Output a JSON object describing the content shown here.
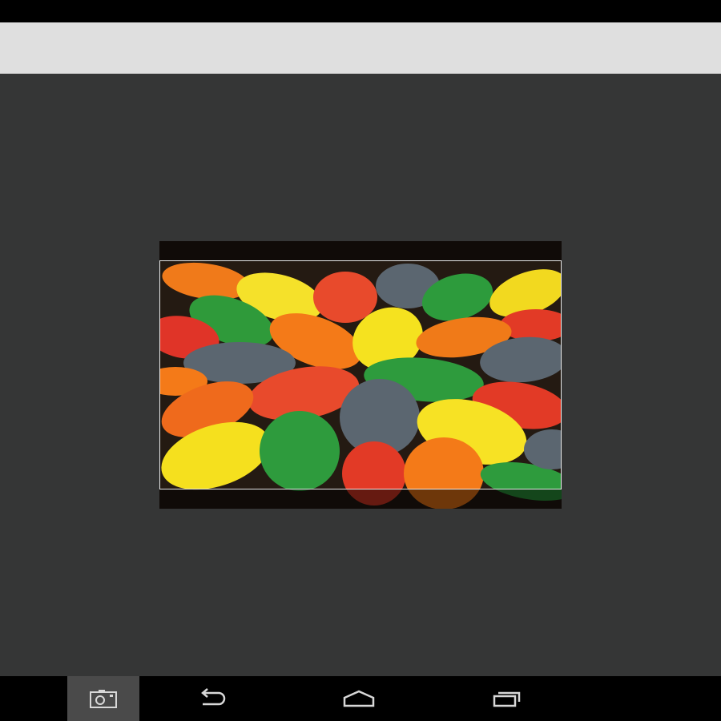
{
  "icons": {
    "screenshot": "camera-icon",
    "back": "back-arrow-icon",
    "home": "home-icon",
    "recents": "recent-apps-icon"
  },
  "colors": {
    "action_bar": "#dfdfdf",
    "workspace": "#353636",
    "crop_border": "#e8e8e8"
  }
}
